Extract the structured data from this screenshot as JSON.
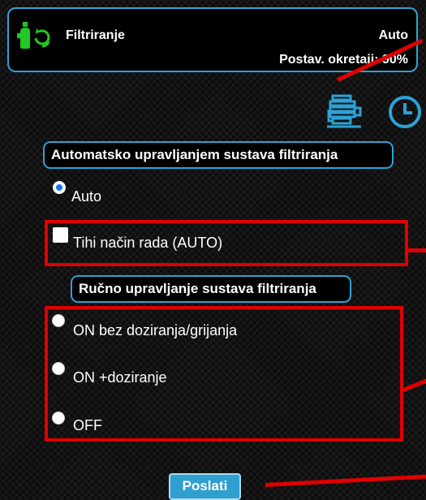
{
  "header": {
    "title": "Filtriranje",
    "mode": "Auto",
    "speed_text": "Postav. okretaji: 90%",
    "device_icon": "filter-pump-icon",
    "sync_icon": "refresh-icon"
  },
  "icons": {
    "pump": "pump-motor-icon",
    "clock": "clock-icon"
  },
  "auto_section": {
    "label": "Automatsko upravljanjem sustava filtriranja",
    "options": [
      {
        "label": "Auto",
        "selected": true
      }
    ],
    "silent_mode": {
      "label": "Tihi način rada (AUTO)",
      "checked": false
    }
  },
  "manual_section": {
    "label": "Ručno upravljanje sustava filtriranja",
    "options": [
      {
        "label": "ON bez doziranja/grijanja",
        "selected": false
      },
      {
        "label": "ON +doziranje",
        "selected": false
      },
      {
        "label": "OFF",
        "selected": false
      }
    ]
  },
  "send_button": {
    "label": "Poslati"
  },
  "colors": {
    "accent_blue": "#2ba3d6",
    "annotation_red": "#e00000",
    "device_green": "#22c922"
  }
}
